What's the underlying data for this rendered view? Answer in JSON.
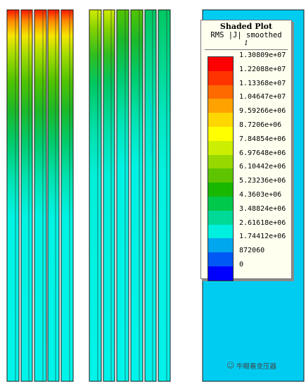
{
  "legend": {
    "title": "Shaded Plot",
    "quantity": "RMS |J| smoothed",
    "subscript": "1",
    "entries": [
      {
        "label": "1.30809e+07",
        "color": "#ff0000"
      },
      {
        "label": "1.22088e+07",
        "color": "#ff3300"
      },
      {
        "label": "1.13368e+07",
        "color": "#ff6a00"
      },
      {
        "label": "1.04647e+07",
        "color": "#ffa200"
      },
      {
        "label": "9.59266e+06",
        "color": "#ffd700"
      },
      {
        "label": "8.7206e+06",
        "color": "#ffff00"
      },
      {
        "label": "7.84854e+06",
        "color": "#ccee00"
      },
      {
        "label": "6.97648e+06",
        "color": "#96d800"
      },
      {
        "label": "6.10442e+06",
        "color": "#5ec400"
      },
      {
        "label": "5.23236e+06",
        "color": "#19b800"
      },
      {
        "label": "4.3603e+06",
        "color": "#00c84a"
      },
      {
        "label": "3.48824e+06",
        "color": "#00d998"
      },
      {
        "label": "2.61618e+06",
        "color": "#00f0e0"
      },
      {
        "label": "1.74412e+06",
        "color": "#00a6ee"
      },
      {
        "label": "872060",
        "color": "#0058f5"
      },
      {
        "label": "0",
        "color": "#0000ff"
      }
    ]
  },
  "watermark": {
    "icon": "wechat-icon",
    "text": "牛眼看变压器"
  }
}
